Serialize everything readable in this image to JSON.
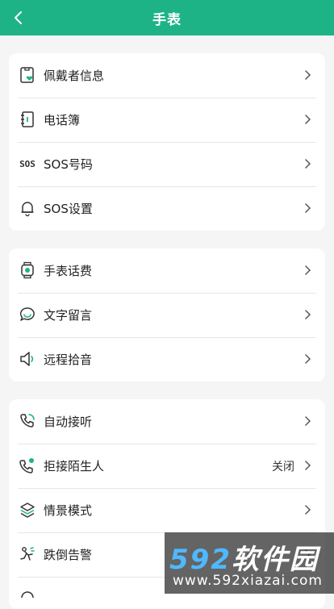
{
  "header": {
    "title": "手表"
  },
  "sections": [
    [
      {
        "label": "佩戴者信息",
        "icon": "wearer-info-icon"
      },
      {
        "label": "电话簿",
        "icon": "phonebook-icon"
      },
      {
        "label": "SOS号码",
        "icon": "sos-icon",
        "icon_text": "SOS"
      },
      {
        "label": "SOS设置",
        "icon": "bell-icon"
      }
    ],
    [
      {
        "label": "手表话费",
        "icon": "watch-icon"
      },
      {
        "label": "文字留言",
        "icon": "chat-bubble-icon"
      },
      {
        "label": "远程拾音",
        "icon": "speaker-icon"
      }
    ],
    [
      {
        "label": "自动接听",
        "icon": "phone-auto-answer-icon"
      },
      {
        "label": "拒接陌生人",
        "icon": "phone-reject-icon",
        "value": "关闭"
      },
      {
        "label": "情景模式",
        "icon": "layers-icon"
      },
      {
        "label": "跌倒告警",
        "icon": "fall-alert-icon"
      }
    ]
  ],
  "watermark": {
    "brand_num": "592",
    "brand_text": "软件园",
    "url": "www.592xiazai.com"
  },
  "colors": {
    "accent": "#1db387",
    "background": "#f5f5f5"
  }
}
